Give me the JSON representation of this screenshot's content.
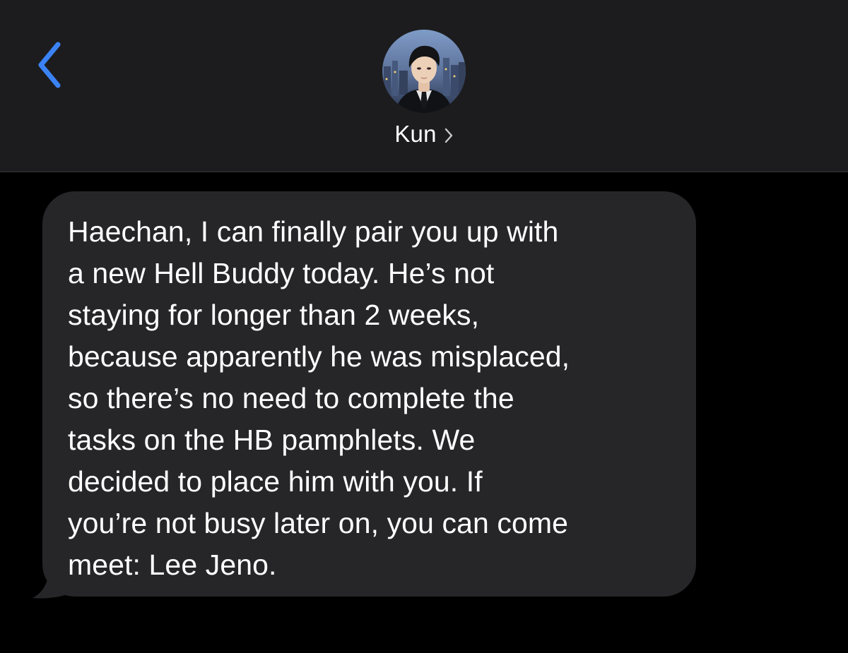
{
  "header": {
    "back_icon": "chevron-left-icon",
    "accent_color": "#3b82f6",
    "contact": {
      "name": "Kun",
      "disclosure_icon": "chevron-right-icon",
      "avatar": "contact-avatar-photo"
    }
  },
  "thread": {
    "messages": [
      {
        "direction": "incoming",
        "bubble_color": "#262629",
        "lines": [
          "Haechan, I can finally pair you up with",
          "a new Hell Buddy today. He’s not",
          "staying for longer than 2 weeks,",
          "because apparently he was misplaced,",
          "so there’s no need to complete the",
          "tasks on the HB pamphlets. We",
          "decided to place him with you. If",
          "you’re not busy later on, you can come",
          "meet: Lee Jeno."
        ]
      }
    ]
  }
}
